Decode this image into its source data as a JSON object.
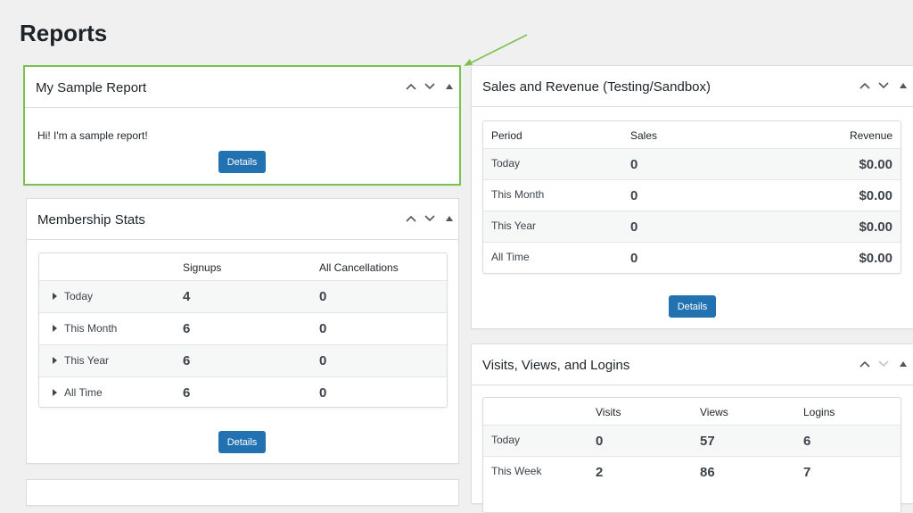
{
  "page": {
    "title": "Reports"
  },
  "sample_report": {
    "title": "My Sample Report",
    "body": "Hi! I'm a sample report!",
    "button": "Details"
  },
  "membership": {
    "title": "Membership Stats",
    "columns": [
      "",
      "Signups",
      "All Cancellations"
    ],
    "rows": [
      {
        "label": "Today",
        "signups": "4",
        "cancellations": "0"
      },
      {
        "label": "This Month",
        "signups": "6",
        "cancellations": "0"
      },
      {
        "label": "This Year",
        "signups": "6",
        "cancellations": "0"
      },
      {
        "label": "All Time",
        "signups": "6",
        "cancellations": "0"
      }
    ],
    "button": "Details"
  },
  "sales": {
    "title": "Sales and Revenue (Testing/Sandbox)",
    "columns": [
      "Period",
      "Sales",
      "Revenue"
    ],
    "rows": [
      {
        "label": "Today",
        "sales": "0",
        "revenue": "$0.00"
      },
      {
        "label": "This Month",
        "sales": "0",
        "revenue": "$0.00"
      },
      {
        "label": "This Year",
        "sales": "0",
        "revenue": "$0.00"
      },
      {
        "label": "All Time",
        "sales": "0",
        "revenue": "$0.00"
      }
    ],
    "button": "Details"
  },
  "visits": {
    "title": "Visits, Views, and Logins",
    "columns": [
      "",
      "Visits",
      "Views",
      "Logins"
    ],
    "rows": [
      {
        "label": "Today",
        "visits": "0",
        "views": "57",
        "logins": "6"
      },
      {
        "label": "This Week",
        "visits": "2",
        "views": "86",
        "logins": "7"
      }
    ]
  },
  "colors": {
    "accent": "#2271b1",
    "highlight": "#7ac14e",
    "arrow": "#7ac14e"
  },
  "icons": [
    "chevron-up-icon",
    "chevron-down-icon",
    "caret-up-icon",
    "caret-right-icon",
    "annotation-arrow"
  ]
}
